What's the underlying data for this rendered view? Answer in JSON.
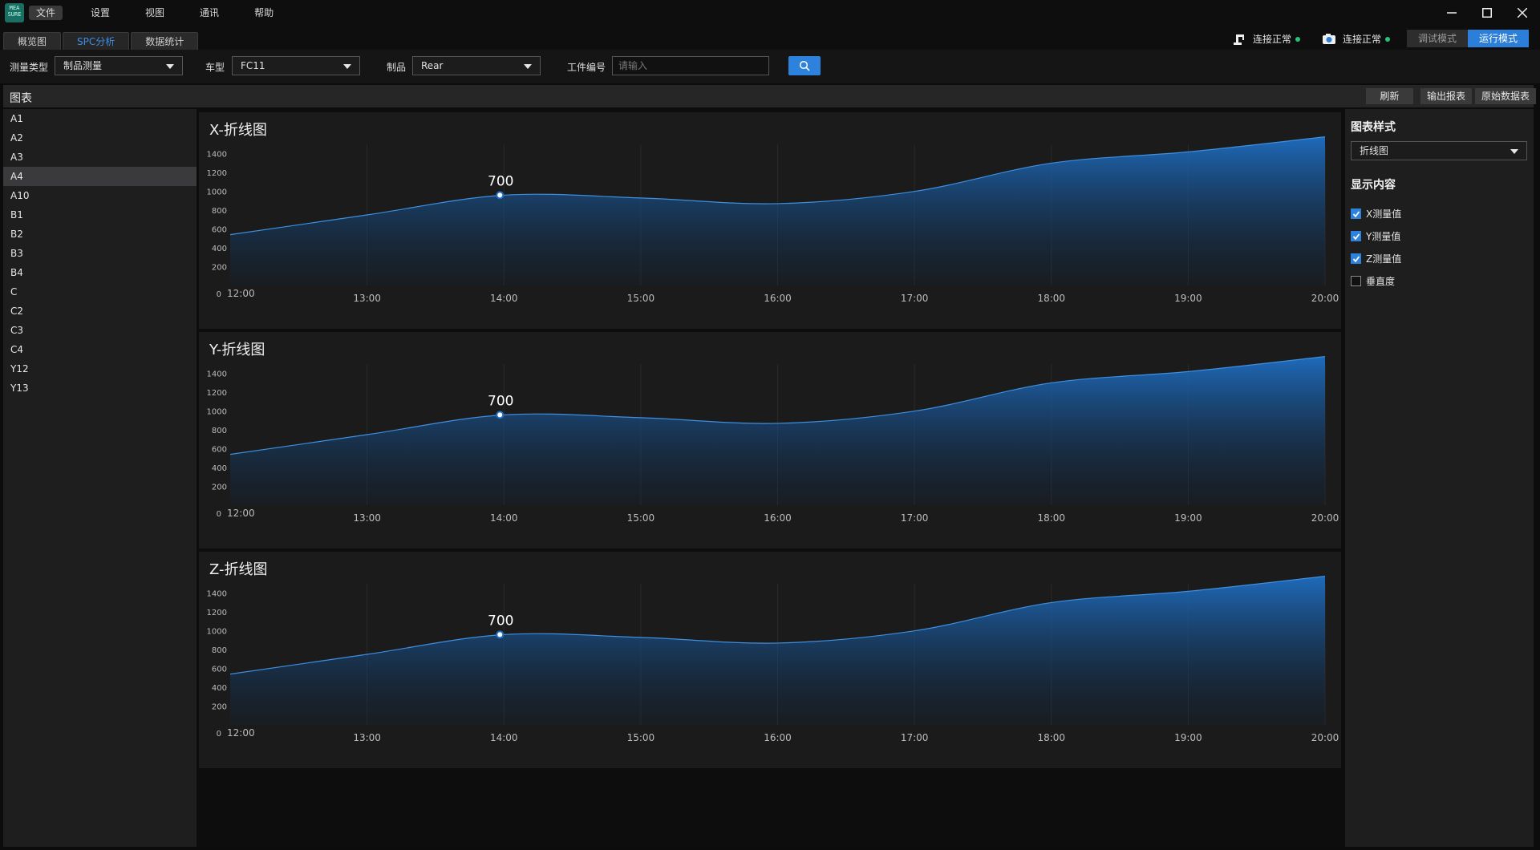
{
  "app": {
    "logo_text": "MEA SURE"
  },
  "menu": [
    "文件",
    "设置",
    "视图",
    "通讯",
    "帮助"
  ],
  "tabs": [
    "概览图",
    "SPC分析",
    "数据统计"
  ],
  "status": [
    {
      "label": "连接正常",
      "icon": "robot-arm-icon",
      "color": "#27c27a"
    },
    {
      "label": "连接正常",
      "icon": "camera-icon",
      "color": "#27c27a"
    }
  ],
  "modes": [
    "调试模式",
    "运行模式"
  ],
  "filters": {
    "measure_type_label": "测量类型",
    "measure_type_value": "制品测量",
    "car_label": "车型",
    "car_value": "FC11",
    "product_label": "制品",
    "product_value": "Rear",
    "workpiece_label": "工件编号",
    "workpiece_placeholder": "请输入"
  },
  "panel": {
    "title": "图表",
    "refresh": "刷新",
    "export": "输出报表",
    "raw": "原始数据表"
  },
  "sidebar": {
    "items": [
      "A1",
      "A2",
      "A3",
      "A4",
      "A10",
      "B1",
      "B2",
      "B3",
      "B4",
      "C",
      "C2",
      "C3",
      "C4",
      "Y12",
      "Y13"
    ],
    "selected": "A4"
  },
  "right_panel": {
    "style_title": "图表样式",
    "style_value": "折线图",
    "content_title": "显示内容",
    "checks": [
      {
        "label": "X测量值",
        "checked": true
      },
      {
        "label": "Y测量值",
        "checked": true
      },
      {
        "label": "Z测量值",
        "checked": true
      },
      {
        "label": "垂直度",
        "checked": false
      }
    ]
  },
  "colors": {
    "accent": "#2c82dc",
    "area_top": "#1f6fc4",
    "area_line": "#3d8fe0"
  },
  "chart_data": [
    {
      "type": "area",
      "title": "X-折线图",
      "x": [
        "12:00",
        "13:00",
        "14:00",
        "15:00",
        "16:00",
        "17:00",
        "18:00",
        "19:00",
        "20:00"
      ],
      "y_ticks": [
        0,
        200,
        400,
        600,
        800,
        1000,
        1200,
        1400
      ],
      "ylim": [
        0,
        1500
      ],
      "values": [
        540,
        750,
        960,
        930,
        870,
        1000,
        1300,
        1420,
        1580
      ],
      "highlight": {
        "x": "14:00",
        "label": "700"
      }
    },
    {
      "type": "area",
      "title": "Y-折线图",
      "x": [
        "12:00",
        "13:00",
        "14:00",
        "15:00",
        "16:00",
        "17:00",
        "18:00",
        "19:00",
        "20:00"
      ],
      "y_ticks": [
        0,
        200,
        400,
        600,
        800,
        1000,
        1200,
        1400
      ],
      "ylim": [
        0,
        1500
      ],
      "values": [
        540,
        750,
        960,
        930,
        870,
        1000,
        1300,
        1420,
        1580
      ],
      "highlight": {
        "x": "14:00",
        "label": "700"
      }
    },
    {
      "type": "area",
      "title": "Z-折线图",
      "x": [
        "12:00",
        "13:00",
        "14:00",
        "15:00",
        "16:00",
        "17:00",
        "18:00",
        "19:00",
        "20:00"
      ],
      "y_ticks": [
        0,
        200,
        400,
        600,
        800,
        1000,
        1200,
        1400
      ],
      "ylim": [
        0,
        1500
      ],
      "values": [
        540,
        750,
        960,
        930,
        870,
        1000,
        1300,
        1420,
        1580
      ],
      "highlight": {
        "x": "14:00",
        "label": "700"
      }
    }
  ]
}
